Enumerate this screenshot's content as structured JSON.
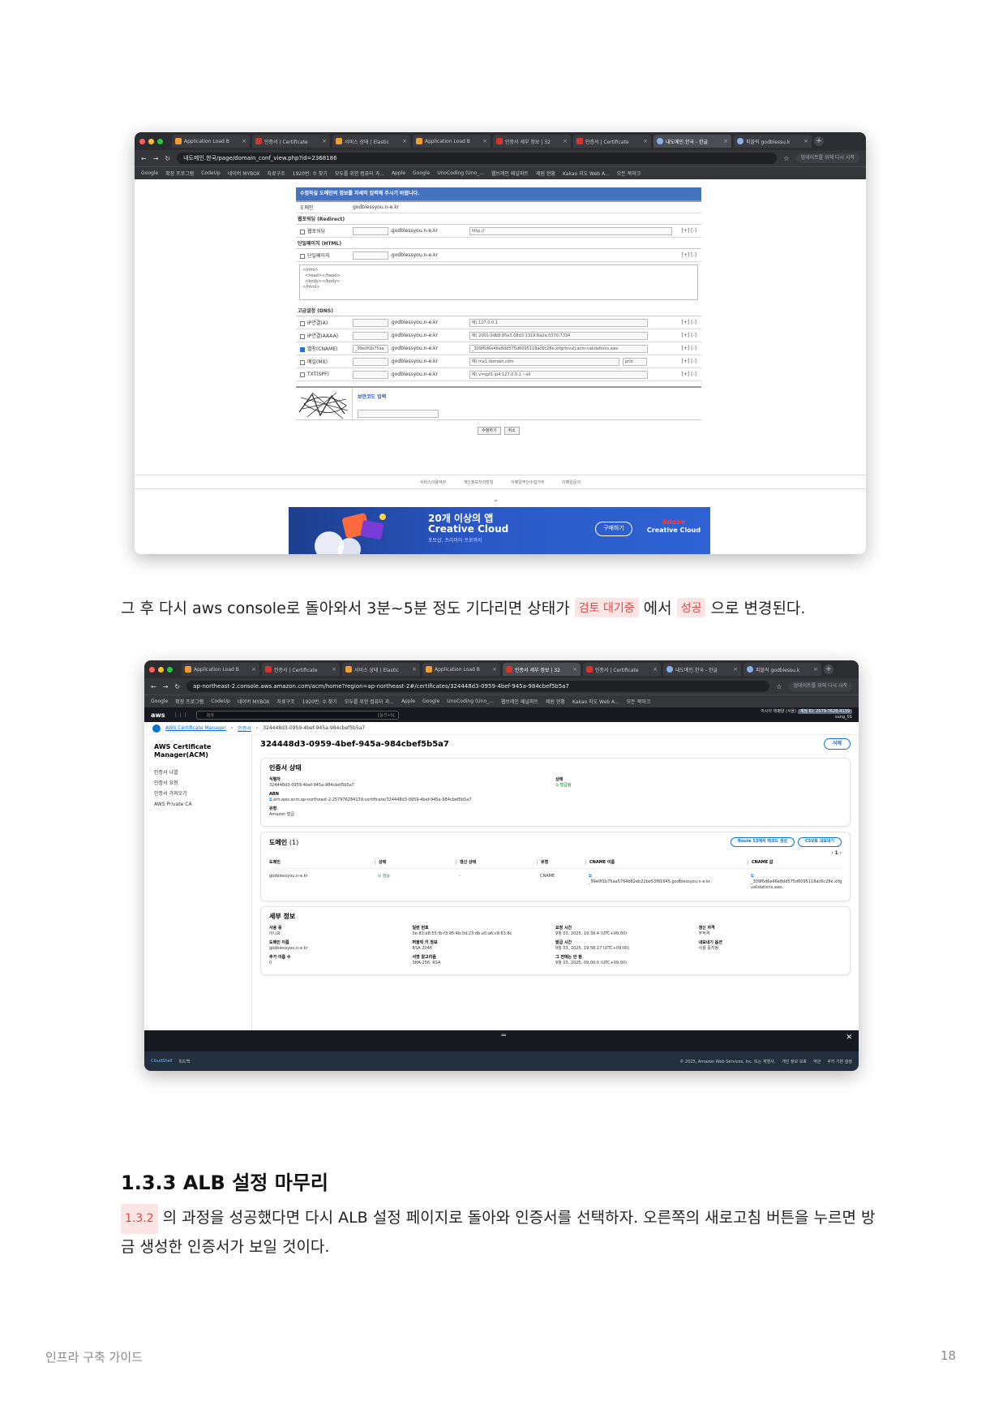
{
  "screenshot1": {
    "tabs": [
      "Application Load B",
      "인증서 | Certificate",
      "서비스 상태 | Elastic",
      "Application Load B",
      "인증서 세부 정보 | 32",
      "인증서 | Certificate",
      "내도메인.한국 - 한글",
      "피블릭 godblessu.k"
    ],
    "url": "내도메인.한국/page/domain_conf_view.php?id=2368186",
    "update_button": "업데이트를 위해 다시 시작",
    "bookmarks": [
      "Google",
      "확장 프로그램",
      "CodeUp",
      "네이버 MYBOX",
      "자료구조",
      "1920번: 수 찾기",
      "모두를 위한 컴퓨터 과...",
      "Apple",
      "Google",
      "UnoCoding (Uno_...",
      "웹브레인 패널퍼트",
      "제원 현황",
      "Kakao 지도 Web A...",
      "모든 북마크"
    ],
    "form": {
      "header": "수정하실 도메인의 정보를 자세히 입력해 주시기 바랍니다.",
      "domain_label": "도메인",
      "domain_value": "godblessyou.n-e.kr",
      "redirect_section": "웹포워딩 (Redirect)",
      "redirect_label": "웹포워딩",
      "redirect_suffix": ".godblessyou.n-e.kr",
      "redirect_placeholder": "http://",
      "html_section": "단일페이지 (HTML)",
      "html_label": "단일페이지",
      "html_suffix": ".godblessyou.n-e.kr",
      "html_text": "<html>\n  <head></head>\n  <body></body>\n</html>",
      "dns_section": "고급설정 (DNS)",
      "dns_rows": [
        {
          "label": "IP연결(A)",
          "sub": "",
          "suffix": ".godblessyou.n-e.kr",
          "value": "예) 127.0.0.1",
          "checked": false
        },
        {
          "label": "IP연결(AAAA)",
          "sub": "",
          "suffix": ".godblessyou.n-e.kr",
          "value": "예) 2001:0db8:85a3:08d3:1319:8a2e:0370:7334",
          "checked": false
        },
        {
          "label": "별칭(CNAME)",
          "sub": "_99e0f1b75aa",
          "suffix": ".godblessyou.n-e.kr",
          "value": "_309f6d6e46e8dd575d6095118ac6c28e.xlfgrmvvlj.acm-validations.aws",
          "checked": true
        },
        {
          "label": "메일(MX)",
          "sub": "",
          "suffix": ".godblessyou.n-e.kr",
          "value": "예) mx1.domain.com",
          "checked": false
        },
        {
          "label": "TXT(SPF)",
          "sub": "",
          "suffix": ".godblessyou.n-e.kr",
          "value": "예) v=spf1 ip4:127.0.0.1 ~all",
          "checked": false
        }
      ],
      "plusminus": "[+] [-]",
      "mx_priority": "prio",
      "captcha_label": "보안코드 입력",
      "submit": "수정하기",
      "cancel": "취소"
    },
    "footer_links": [
      "서비스이용약관",
      "개인정보처리방침",
      "이메일무단수집거부",
      "이메일문의"
    ],
    "banner": {
      "title": "20개 이상의 앱\nCreative Cloud",
      "sub": "포토샵, 프리미어 프로까지",
      "button": "구매하기",
      "brand_top": "Adobe",
      "brand": "Creative Cloud"
    }
  },
  "paragraph1": {
    "before": "그 후 다시 aws console로 돌아와서 3분~5분 정도 기다리면 상태가 ",
    "chip1": "검토 대기중",
    "middle": " 에서 ",
    "chip2": "성공",
    "after": " 으로 변경된다."
  },
  "screenshot2": {
    "url": "ap-northeast-2.console.aws.amazon.com/acm/home?region=ap-northeast-2#/certificates/324448d3-0959-4bef-945a-984cbef5b5a7",
    "update_button": "업데이트를 위해 다시 시작",
    "aws": {
      "logo": "aws",
      "search_placeholder": "검색",
      "search_key": "[옵션+S]",
      "region": "아시아 태평양 (서울)",
      "account_id": "계정 ID: 2579-7628-4139",
      "user": "sung_01"
    },
    "breadcrumb": [
      "AWS Certificate Manager",
      "인증서",
      "324448d3-0959-4bef-945a-984cbef5b5a7"
    ],
    "sidenav": {
      "title": "AWS Certificate Manager(ACM)",
      "items": [
        "인증서 나열",
        "인증서 요청",
        "인증서 가져오기",
        "AWS Private CA"
      ]
    },
    "title": "324448d3-0959-4bef-945a-984cbef5b5a7",
    "delete": "삭제",
    "status_card": {
      "header": "인증서 상태",
      "id_label": "식별자",
      "id_value": "324448d3-0959-4bef-945a-984cbef5b5a7",
      "status_label": "상태",
      "status_value": "발급됨",
      "arn_label": "ARN",
      "arn_value": "arn:aws:acm:ap-northeast-2:257976284139:certificate/324448d3-0959-4bef-945a-984cbef5b5a7",
      "type_label": "유형",
      "type_value": "Amazon 발급"
    },
    "domain_card": {
      "header": "도메인",
      "count": "(1)",
      "btn_route53": "Route 53에서 레코드 생성",
      "btn_csv": "CSV로 내보내기",
      "page": "1",
      "columns": [
        "도메인",
        "상태",
        "갱신 상태",
        "유형",
        "CNAME 이름",
        "CNAME 값"
      ],
      "row": [
        "godblessyou.n-e.kr",
        "성공",
        "-",
        "CNAME",
        "_99e0f1b75aa5764b82eb22be53f81645.godblessyou.n-e.kr.",
        "_309f6d6e46e8dd575d6095118ac6c28e.xlfgrmvvlj.acm-validations.aws."
      ]
    },
    "detail_card": {
      "header": "세부 정보",
      "items": [
        {
          "k": "사용 중",
          "v": "아니요"
        },
        {
          "k": "일련 번호",
          "v": "0e:83:e8:55:fb:f3:95:4b:0d:23:db:a5:a6:c9:63:8c"
        },
        {
          "k": "요청 시간",
          "v": "9월 03, 2025, 19:39:4 (UTC+09:00)"
        },
        {
          "k": "갱신 자격",
          "v": "부적격"
        },
        {
          "k": "도메인 이름",
          "v": "godblessyou.n-e.kr"
        },
        {
          "k": "퍼블릭 키 정보",
          "v": "RSA 2048"
        },
        {
          "k": "발급 시간",
          "v": "9월 03, 2025, 19:58:17 (UTC+09:00)"
        },
        {
          "k": "내보내기 옵션",
          "v": "사용 중지됨"
        },
        {
          "k": "추가 이름 수",
          "v": "0"
        },
        {
          "k": "서명 알고리즘",
          "v": "SHA-256, RSA"
        },
        {
          "k": "그 전에는 안 됨",
          "v": "9월 03, 2025, 09:00:0 (UTC+09:00)"
        },
        {
          "k": "",
          "v": ""
        }
      ]
    },
    "footer": {
      "cloudshell": "CloudShell",
      "feedback": "피드백",
      "copyright": "© 2025, Amazon Web Services, Inc. 또는 계열사.",
      "links": [
        "개인 정보 보호",
        "약관",
        "쿠키 기본 설정"
      ]
    }
  },
  "section": {
    "heading": "1.3.3 ALB 설정 마무리",
    "chip": "1.3.2",
    "text": " 의 과정을 성공했다면 다시 ALB 설정 페이지로 돌아와 인증서를 선택하자. 오른쪽의 새로고침 버튼을 누르면 방금 생성한 인증서가 보일 것이다."
  },
  "footer": {
    "left": "인프라 구축 가이드",
    "page": "18"
  }
}
